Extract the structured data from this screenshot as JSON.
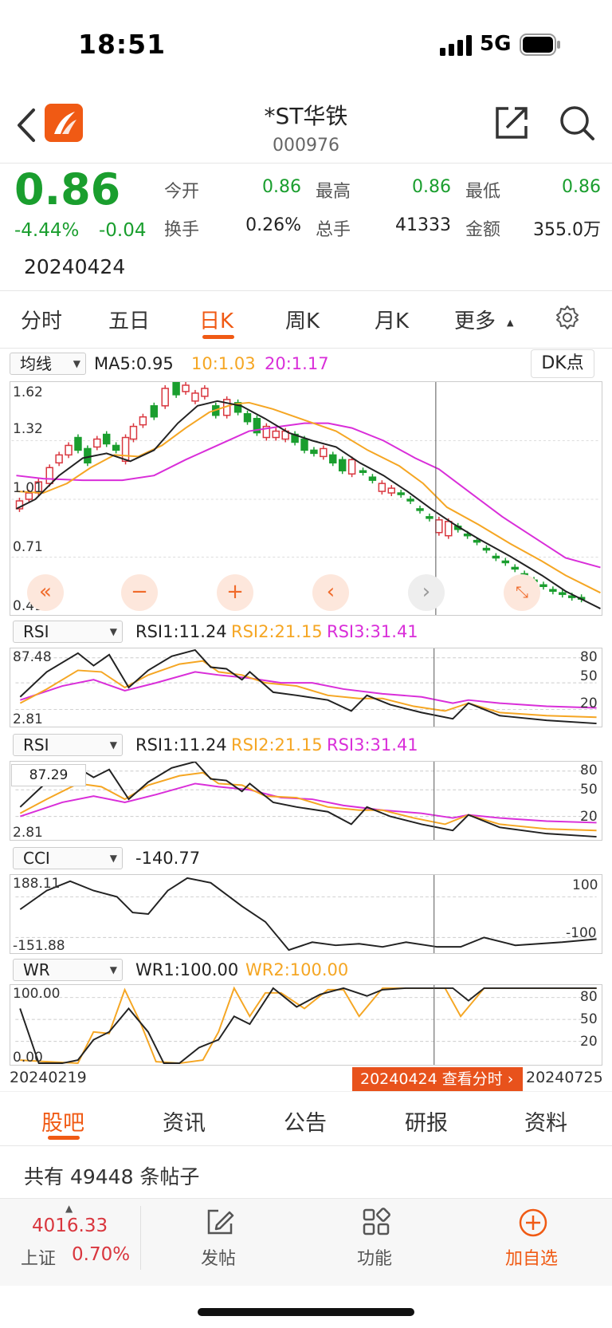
{
  "status_bar": {
    "time": "18:51",
    "network": "5G"
  },
  "header": {
    "title": "*ST华铁",
    "code": "000976"
  },
  "quote": {
    "price": "0.86",
    "change_pct": "-4.44%",
    "change": "-0.04",
    "date": "20240424",
    "open_label": "今开",
    "open": "0.86",
    "high_label": "最高",
    "high": "0.86",
    "low_label": "最低",
    "low": "0.86",
    "turnover_label": "换手",
    "turnover": "0.26%",
    "volume_label": "总手",
    "volume": "41333",
    "amount_label": "金额",
    "amount": "355.0万"
  },
  "period_tabs": [
    {
      "label": "分时"
    },
    {
      "label": "五日"
    },
    {
      "label": "日K"
    },
    {
      "label": "周K"
    },
    {
      "label": "月K"
    },
    {
      "label": "更多"
    }
  ],
  "ma_bar": {
    "select": "均线",
    "ma5": "MA5:0.95",
    "ma10": "10:1.03",
    "ma20": "20:1.17",
    "dk_button": "DK点"
  },
  "kline": {
    "y_labels": [
      "1.62",
      "1.32",
      "1.01",
      "0.71",
      "0.41"
    ]
  },
  "rsi1": {
    "select": "RSI",
    "v1": "RSI1:11.24",
    "v2": "RSI2:21.15",
    "v3": "RSI3:31.41",
    "max": "87.48",
    "min": "2.81",
    "levels": [
      "80",
      "50",
      "20"
    ]
  },
  "rsi2": {
    "select": "RSI",
    "v1": "RSI1:11.24",
    "v2": "RSI2:21.15",
    "v3": "RSI3:31.41",
    "max": "87.29",
    "min": "2.81",
    "levels": [
      "80",
      "50",
      "20"
    ]
  },
  "cci": {
    "select": "CCI",
    "v": "-140.77",
    "max": "188.11",
    "min": "-151.88",
    "levels": [
      "100",
      "-100"
    ]
  },
  "wr": {
    "select": "WR",
    "v1": "WR1:100.00",
    "v2": "WR2:100.00",
    "max": "100.00",
    "min": "0.00",
    "levels": [
      "80",
      "50",
      "20"
    ]
  },
  "x_axis": {
    "start": "20240219",
    "end": "20240725",
    "cursor_label": "20240424 查看分时"
  },
  "colors": {
    "up": "#d9363e",
    "down": "#1a9e2e",
    "ma5": "#222222",
    "ma10": "#f5a623",
    "ma20": "#d92ed9",
    "accent": "#f05a14"
  },
  "bottom_tabs": [
    {
      "label": "股吧"
    },
    {
      "label": "资讯"
    },
    {
      "label": "公告"
    },
    {
      "label": "研报"
    },
    {
      "label": "资料"
    }
  ],
  "posts": {
    "text": "共有 49448 条帖子"
  },
  "toolbar": {
    "index_value": "4016.33",
    "index_name": "上证",
    "index_change": "0.70%",
    "post_label": "发帖",
    "func_label": "功能",
    "watch_label": "加自选"
  }
}
